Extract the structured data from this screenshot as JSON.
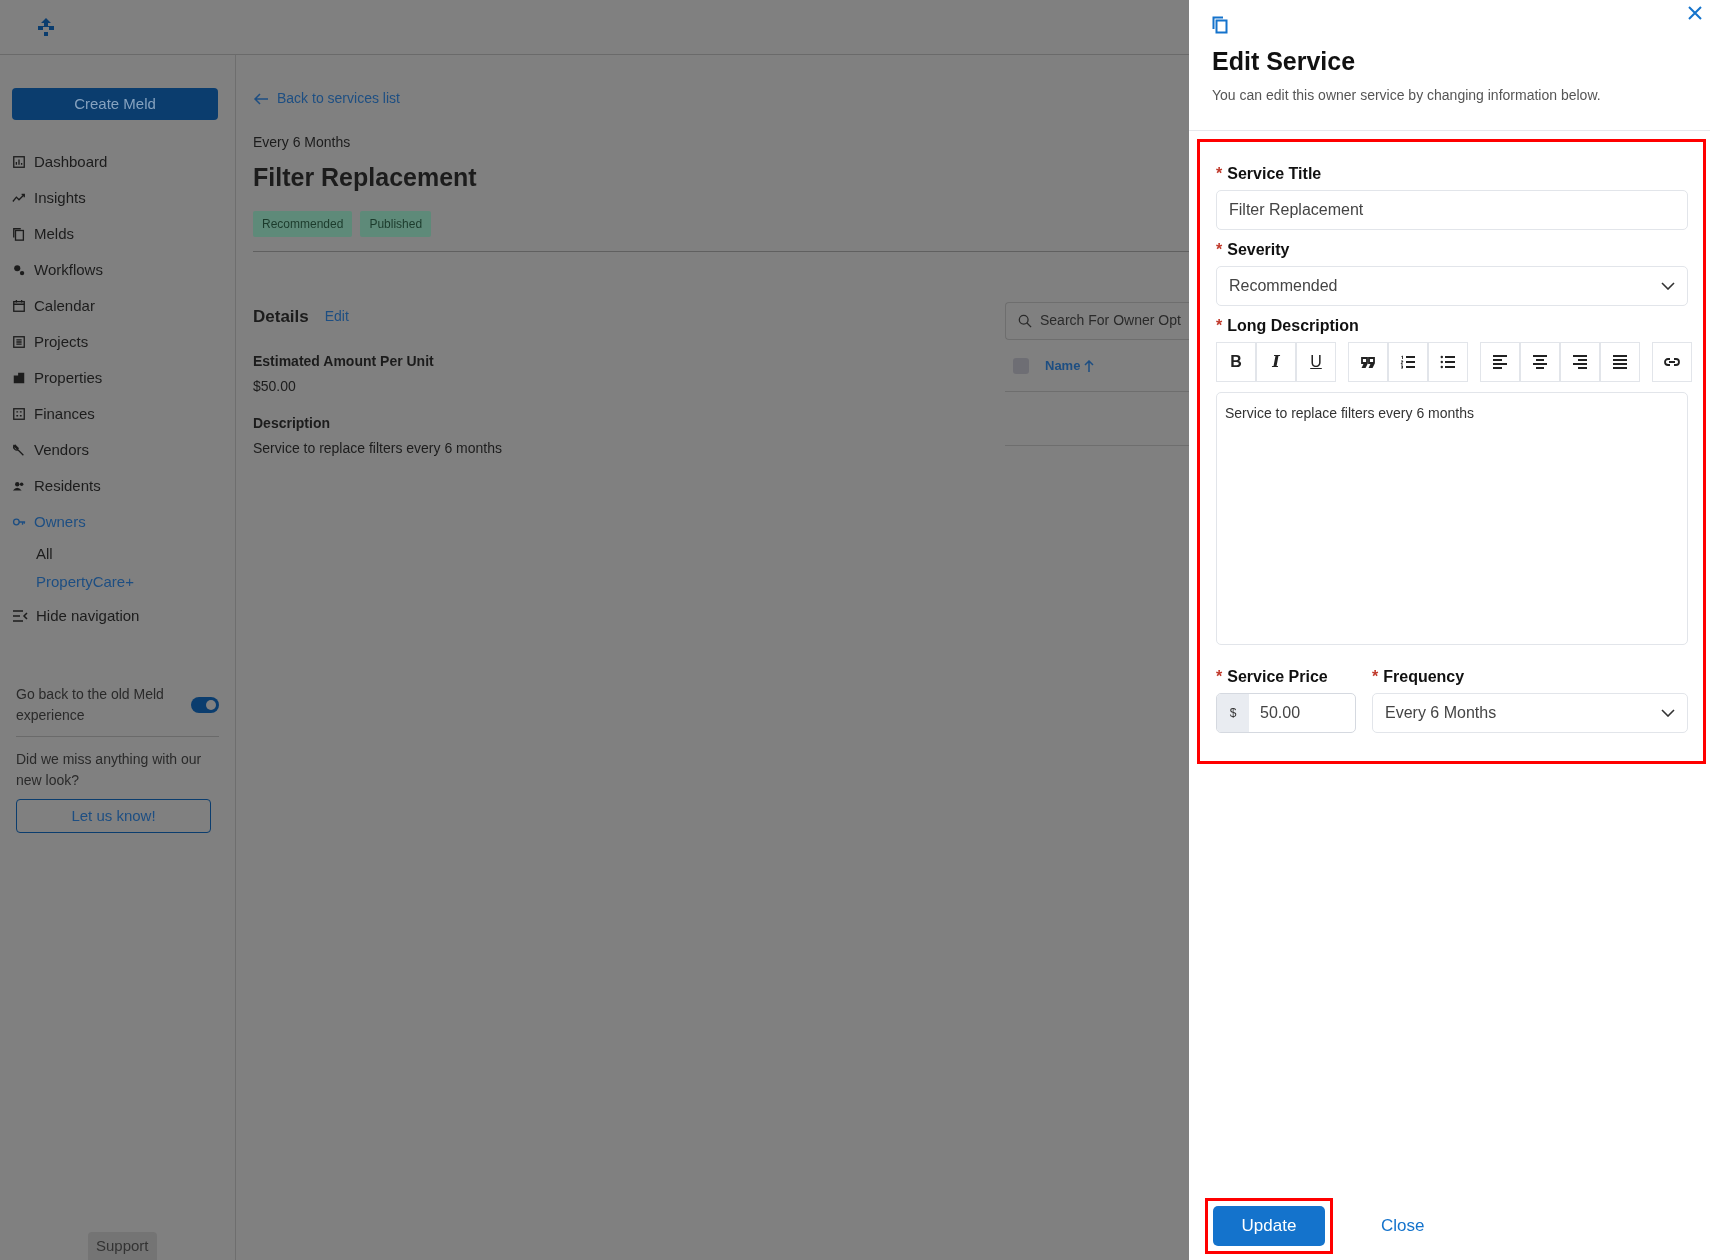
{
  "sidebar": {
    "create_button": "Create Meld",
    "nav": [
      {
        "label": "Dashboard",
        "selected": false
      },
      {
        "label": "Insights",
        "selected": false
      },
      {
        "label": "Melds",
        "selected": false
      },
      {
        "label": "Workflows",
        "selected": false
      },
      {
        "label": "Calendar",
        "selected": false
      },
      {
        "label": "Projects",
        "selected": false
      },
      {
        "label": "Properties",
        "selected": false
      },
      {
        "label": "Finances",
        "selected": false
      },
      {
        "label": "Vendors",
        "selected": false
      },
      {
        "label": "Residents",
        "selected": false
      },
      {
        "label": "Owners",
        "selected": true,
        "children": [
          {
            "label": "All",
            "selected": false
          },
          {
            "label": "PropertyCare+",
            "selected": true
          }
        ]
      }
    ],
    "hide_navigation": "Hide navigation",
    "old_experience": {
      "label": "Go back to the old Meld experience",
      "on": true
    },
    "feedback": {
      "prompt": "Did we miss anything with our new look?",
      "button": "Let us know!"
    },
    "support": "Support"
  },
  "main": {
    "back_link": "Back to services list",
    "frequency": "Every 6 Months",
    "title": "Filter Replacement",
    "badges": [
      "Recommended",
      "Published"
    ],
    "details": {
      "heading": "Details",
      "edit_link": "Edit",
      "fields": [
        {
          "label": "Estimated Amount Per Unit",
          "value": "$50.00"
        },
        {
          "label": "Description",
          "value": "Service to replace filters every 6 months"
        }
      ]
    },
    "search": {
      "placeholder": "Search For Owner Opt"
    },
    "table": {
      "select_all_checked": false,
      "columns": [
        "Name"
      ]
    }
  },
  "drawer": {
    "title": "Edit Service",
    "subtitle": "You can edit this owner service by changing information below.",
    "form_highlighted": true,
    "fields": [
      {
        "kind": "text",
        "required_mark": "*",
        "label": "Service Title",
        "value": "Filter Replacement"
      },
      {
        "kind": "select",
        "required_mark": "*",
        "label": "Severity",
        "value": "Recommended"
      },
      {
        "kind": "editor",
        "required_mark": "*",
        "label": "Long Description",
        "format_keys": [
          "B",
          "I",
          "U"
        ],
        "value": "Service to replace filters every 6 months"
      }
    ],
    "inline_fields": [
      {
        "kind": "money",
        "required_mark": "*",
        "label": "Service Price",
        "prefix": "$",
        "value": "50.00"
      },
      {
        "kind": "select",
        "required_mark": "*",
        "label": "Frequency",
        "value": "Every 6 Months"
      }
    ],
    "update_button": {
      "label": "Update",
      "highlighted": true
    },
    "close_link": "Close"
  }
}
